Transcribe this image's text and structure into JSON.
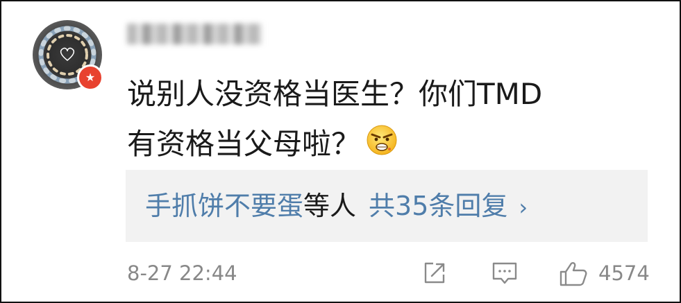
{
  "comment": {
    "text_line1": "说别人没资格当医生？你们TMD",
    "text_line2": "有资格当父母啦？",
    "emoji_icon": "angry-face-icon"
  },
  "user": {
    "name_blurred": "",
    "badge_icon": "verified-star-badge-icon",
    "badge_color": "#e8422f"
  },
  "replies": {
    "users_label": "手抓饼不要蛋",
    "suffix_label": "等人",
    "count_label": "共35条回复",
    "chevron_icon": "chevron-right-icon",
    "link_color": "#4f7daa"
  },
  "footer": {
    "timestamp": "8-27 22:44",
    "share_icon": "share-icon",
    "comment_icon": "comment-icon",
    "like_icon": "thumbs-up-icon",
    "like_count": "4574"
  }
}
